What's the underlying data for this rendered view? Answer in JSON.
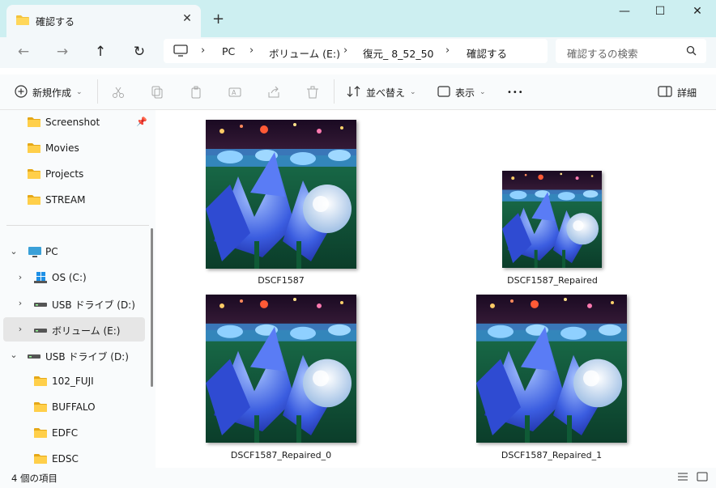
{
  "window": {
    "tab_title": "確認する",
    "new_tab_label": "+",
    "minimize_label": "—",
    "maximize_label": "☐",
    "close_label": "✕"
  },
  "address": {
    "crumbs": [
      "PC",
      "ボリューム (E:)",
      "復元_ 8_52_50",
      "確認する"
    ],
    "separator": "›",
    "search_placeholder": "確認するの検索"
  },
  "toolbar": {
    "new_label": "新規作成",
    "sort_label": "並べ替え",
    "view_label": "表示",
    "more_label": "•••",
    "details_label": "詳細"
  },
  "sidebar": {
    "quick_items": [
      {
        "label": "Screenshot",
        "pinned": true
      },
      {
        "label": "Movies"
      },
      {
        "label": "Projects"
      },
      {
        "label": "STREAM"
      }
    ],
    "pc_label": "PC",
    "drives": [
      {
        "label": "OS (C:)",
        "icon": "windows-drive-icon"
      },
      {
        "label": "USB ドライブ (D:)",
        "icon": "drive-icon"
      },
      {
        "label": "ボリューム (E:)",
        "icon": "drive-icon",
        "selected": true
      },
      {
        "label": "USB ドライブ (D:)",
        "icon": "drive-icon",
        "expanded": true
      }
    ],
    "sub_folders": [
      "102_FUJI",
      "BUFFALO",
      "EDFC",
      "EDSC"
    ]
  },
  "files": [
    {
      "name": "DSCF1587"
    },
    {
      "name": "DSCF1587_Repaired"
    },
    {
      "name": "DSCF1587_Repaired_0"
    },
    {
      "name": "DSCF1587_Repaired_1"
    }
  ],
  "status": {
    "count_text": "4 個の項目"
  },
  "colors": {
    "titlebar": "#cdeff1",
    "folder": "#f3c23c",
    "selected": "#e6e6e6",
    "accent": "#0067c0"
  }
}
